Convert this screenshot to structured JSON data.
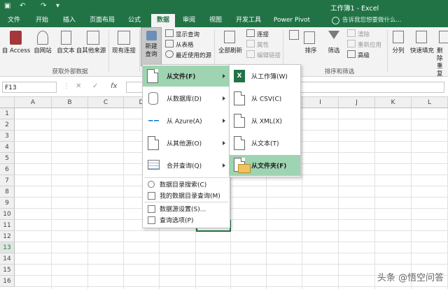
{
  "window": {
    "title": "工作簿1 - Excel"
  },
  "tabs": [
    "文件",
    "开始",
    "插入",
    "页面布局",
    "公式",
    "数据",
    "审阅",
    "视图",
    "开发工具",
    "Power Pivot"
  ],
  "active_tab": "数据",
  "tell_me": "告诉我您想要做什么...",
  "ribbon": {
    "get_external": {
      "buttons": [
        "自 Access",
        "自网站",
        "自文本",
        "自其他来源",
        "现有连接"
      ],
      "group_label": "获取外部数据"
    },
    "get_transform": {
      "new_query": "新建\n查询",
      "new_query_l1": "新建",
      "new_query_l2": "查询",
      "show_queries": "显示查询",
      "from_table": "从表格",
      "recent_sources": "最近使用的源"
    },
    "connections": {
      "refresh_all": "全部刷新",
      "connections": "连接",
      "properties": "属性",
      "edit_links": "编辑链接"
    },
    "sort_filter": {
      "sort": "排序",
      "filter": "筛选",
      "clear": "清除",
      "reapply": "重新应用",
      "advanced": "高级",
      "group_label": "排序和筛选"
    },
    "data_tools": {
      "split": "分列",
      "flash_fill": "快速填充",
      "remove_dup": "删除\n重复项",
      "remove_dup_l1": "删除",
      "remove_dup_l2": "重复"
    }
  },
  "formula_bar": {
    "name_box": "F13",
    "fx": "fx",
    "cancel": "✕",
    "enter": "✓"
  },
  "grid": {
    "columns": [
      "A",
      "B",
      "C",
      "D",
      "E",
      "F",
      "G",
      "H",
      "I",
      "J",
      "K",
      "L"
    ],
    "rows": [
      "1",
      "2",
      "3",
      "4",
      "5",
      "6",
      "7",
      "8",
      "9",
      "10",
      "11",
      "12",
      "13",
      "14",
      "15",
      "16"
    ],
    "selected_row": "13"
  },
  "menu_main": {
    "items": [
      {
        "label": "从文件(F)",
        "highlighted": true,
        "submenu": true
      },
      {
        "label": "从数据库(D)",
        "submenu": true
      },
      {
        "label": "从 Azure(A)",
        "submenu": true
      },
      {
        "label": "从其他源(O)",
        "submenu": true
      },
      {
        "label": "合并查询(Q)",
        "submenu": true
      }
    ],
    "small_items": [
      "数据目录搜索(C)",
      "我的数据目录查询(M)",
      "数据源设置(S)...",
      "查询选项(P)"
    ]
  },
  "menu_sub": {
    "items": [
      {
        "label": "从工作簿(W)"
      },
      {
        "label": "从 CSV(C)"
      },
      {
        "label": "从 XML(X)"
      },
      {
        "label": "从文本(T)"
      },
      {
        "label": "从文件夹(F)",
        "highlighted": true
      }
    ]
  },
  "watermark": "头条 @悟空问答",
  "colors": {
    "excel_green": "#217346",
    "menu_highlight": "#9ed4b1",
    "arrow": "#e23a3a"
  }
}
